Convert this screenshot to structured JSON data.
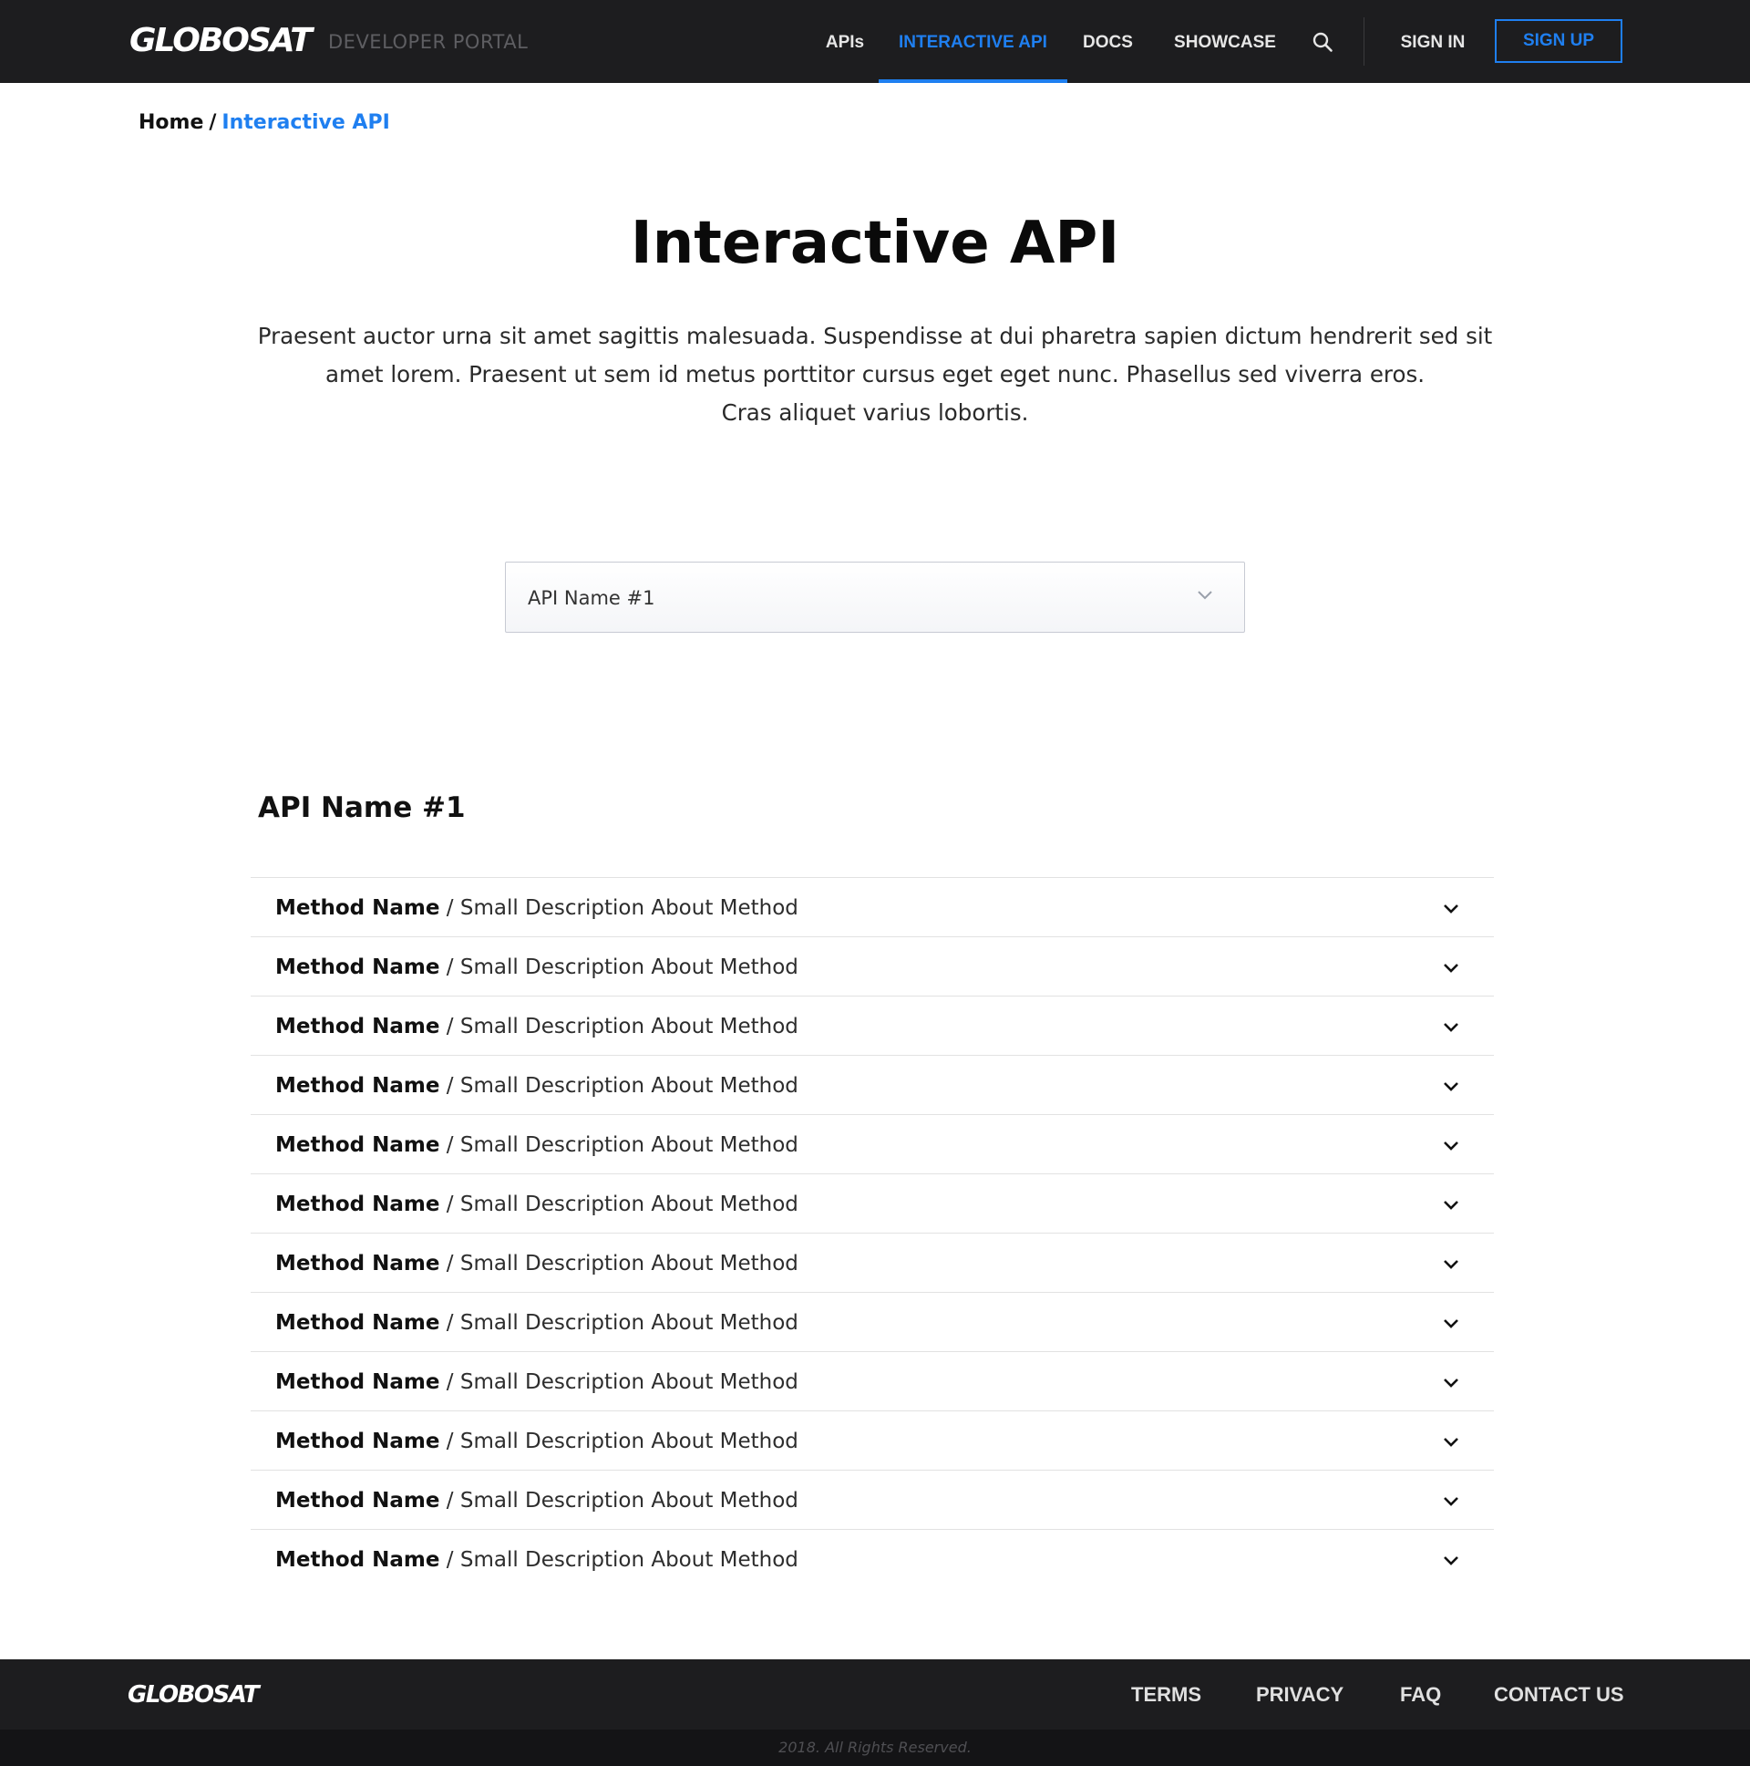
{
  "header": {
    "logo": "GLOBOSAT",
    "portal_label": "DEVELOPER PORTAL",
    "nav": {
      "apis": "APIs",
      "interactive_api": "INTERACTIVE API",
      "docs": "DOCS",
      "showcase": "SHOWCASE"
    },
    "sign_in": "SIGN IN",
    "sign_up": "SIGN UP"
  },
  "breadcrumb": {
    "home": "Home",
    "separator": "/",
    "current": "Interactive API"
  },
  "page": {
    "title": "Interactive API",
    "intro_lines": [
      "Praesent auctor urna sit amet sagittis malesuada. Suspendisse at dui pharetra sapien dictum hendrerit sed sit",
      "amet lorem. Praesent ut sem id metus porttitor cursus eget eget nunc. Phasellus sed viverra eros.",
      "Cras aliquet varius lobortis."
    ]
  },
  "api_select": {
    "selected": "API Name #1"
  },
  "api_section": {
    "heading": "API Name #1",
    "methods": [
      {
        "name": "Method Name",
        "separator": " / ",
        "description": "Small Description About Method"
      },
      {
        "name": "Method Name",
        "separator": " / ",
        "description": "Small Description About Method"
      },
      {
        "name": "Method Name",
        "separator": " / ",
        "description": "Small Description About Method"
      },
      {
        "name": "Method Name",
        "separator": " / ",
        "description": "Small Description About Method"
      },
      {
        "name": "Method Name",
        "separator": " / ",
        "description": "Small Description About Method"
      },
      {
        "name": "Method Name",
        "separator": " / ",
        "description": "Small Description About Method"
      },
      {
        "name": "Method Name",
        "separator": " / ",
        "description": "Small Description About Method"
      },
      {
        "name": "Method Name",
        "separator": " / ",
        "description": "Small Description About Method"
      },
      {
        "name": "Method Name",
        "separator": " / ",
        "description": "Small Description About Method"
      },
      {
        "name": "Method Name",
        "separator": " / ",
        "description": "Small Description About Method"
      },
      {
        "name": "Method Name",
        "separator": " / ",
        "description": "Small Description About Method"
      },
      {
        "name": "Method Name",
        "separator": " / ",
        "description": "Small Description About Method"
      }
    ]
  },
  "footer": {
    "logo": "GLOBOSAT",
    "links": {
      "terms": "TERMS",
      "privacy": "PRIVACY",
      "faq": "FAQ",
      "contact": "CONTACT US"
    },
    "copyright": "2018. All Rights Reserved."
  },
  "icons": {
    "search": "search-icon",
    "chevron": "chevron-down-icon"
  },
  "colors": {
    "header_bg": "#1d1d1f",
    "accent": "#1f7ff0",
    "footer_bottom_bg": "#141416"
  }
}
